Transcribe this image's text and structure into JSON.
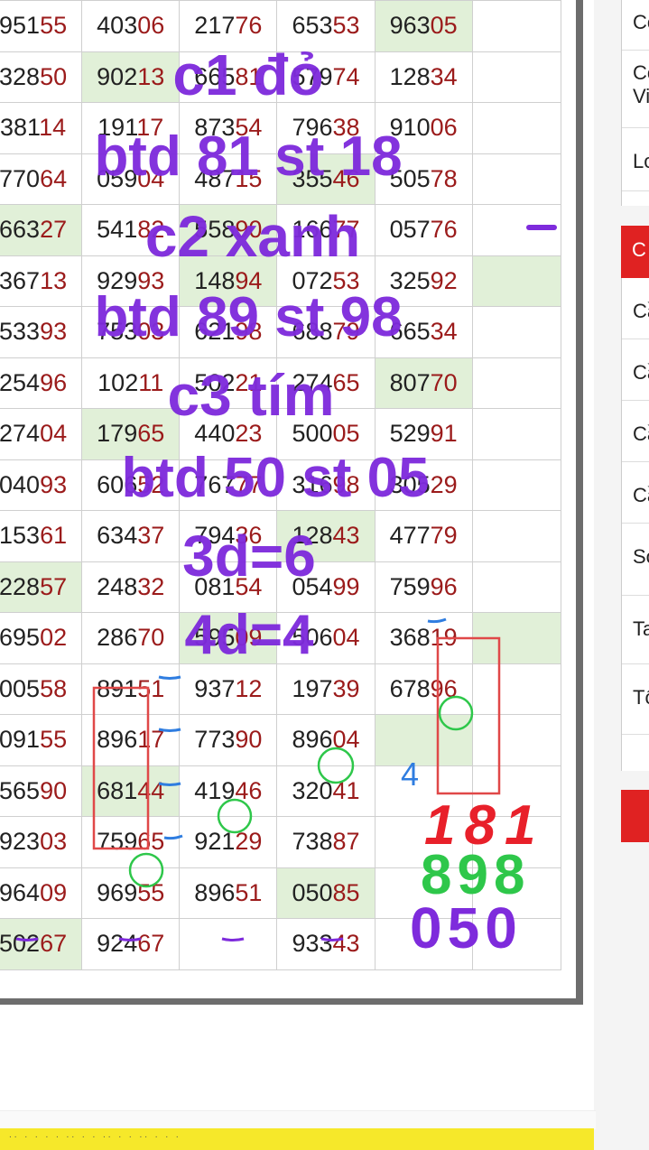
{
  "table": {
    "rows": [
      [
        {
          "v": "95155"
        },
        {
          "v": "40306"
        },
        {
          "v": "21776"
        },
        {
          "v": "65353"
        },
        {
          "v": "96305",
          "hl": true
        },
        {
          "v": ""
        }
      ],
      [
        {
          "v": "32850"
        },
        {
          "v": "90213",
          "hl": true
        },
        {
          "v": "66581"
        },
        {
          "v": "57974"
        },
        {
          "v": "12834"
        },
        {
          "v": ""
        }
      ],
      [
        {
          "v": "38114"
        },
        {
          "v": "19117"
        },
        {
          "v": "87354"
        },
        {
          "v": "79638"
        },
        {
          "v": "91006"
        },
        {
          "v": ""
        }
      ],
      [
        {
          "v": "77064"
        },
        {
          "v": "05904"
        },
        {
          "v": "48715"
        },
        {
          "v": "35546",
          "hl": true
        },
        {
          "v": "50578"
        },
        {
          "v": ""
        }
      ],
      [
        {
          "v": "66327",
          "hl": true
        },
        {
          "v": "54182"
        },
        {
          "v": "55890",
          "hl": true
        },
        {
          "v": "16677"
        },
        {
          "v": "05776"
        },
        {
          "v": ""
        }
      ],
      [
        {
          "v": "36713"
        },
        {
          "v": "92993"
        },
        {
          "v": "14894",
          "hl": true
        },
        {
          "v": "07253"
        },
        {
          "v": "32592"
        },
        {
          "v": "",
          "hl": true
        }
      ],
      [
        {
          "v": "53393"
        },
        {
          "v": "75303"
        },
        {
          "v": "62198"
        },
        {
          "v": "68879"
        },
        {
          "v": "66534"
        },
        {
          "v": ""
        }
      ],
      [
        {
          "v": "25496"
        },
        {
          "v": "10211"
        },
        {
          "v": "50221"
        },
        {
          "v": "27465"
        },
        {
          "v": "80770",
          "hl": true
        },
        {
          "v": ""
        }
      ],
      [
        {
          "v": "27404"
        },
        {
          "v": "17965",
          "hl": true
        },
        {
          "v": "44023"
        },
        {
          "v": "50005"
        },
        {
          "v": "52991"
        },
        {
          "v": ""
        }
      ],
      [
        {
          "v": "04093"
        },
        {
          "v": "60652"
        },
        {
          "v": "76777"
        },
        {
          "v": "31698"
        },
        {
          "v": "30529"
        },
        {
          "v": ""
        }
      ],
      [
        {
          "v": "15361"
        },
        {
          "v": "63437"
        },
        {
          "v": "79436"
        },
        {
          "v": "12843",
          "hl": true
        },
        {
          "v": "47779"
        },
        {
          "v": ""
        }
      ],
      [
        {
          "v": "22857",
          "hl": true
        },
        {
          "v": "24832"
        },
        {
          "v": "08154"
        },
        {
          "v": "05499"
        },
        {
          "v": "75996"
        },
        {
          "v": ""
        }
      ],
      [
        {
          "v": "69502"
        },
        {
          "v": "28670"
        },
        {
          "v": "59509",
          "hl": true
        },
        {
          "v": "50604"
        },
        {
          "v": "36819"
        },
        {
          "v": "",
          "hl": true
        }
      ],
      [
        {
          "v": "00558"
        },
        {
          "v": "89151"
        },
        {
          "v": "93712"
        },
        {
          "v": "19739"
        },
        {
          "v": "67896"
        },
        {
          "v": ""
        }
      ],
      [
        {
          "v": "09155"
        },
        {
          "v": "89617"
        },
        {
          "v": "77390"
        },
        {
          "v": "89604"
        },
        {
          "v": "",
          "hl": true
        },
        {
          "v": ""
        }
      ],
      [
        {
          "v": "56590"
        },
        {
          "v": "68144",
          "hl": true
        },
        {
          "v": "41946"
        },
        {
          "v": "32041"
        },
        {
          "v": ""
        },
        {
          "v": ""
        }
      ],
      [
        {
          "v": "92303"
        },
        {
          "v": "75965"
        },
        {
          "v": "92129"
        },
        {
          "v": "73887"
        },
        {
          "v": ""
        },
        {
          "v": ""
        }
      ],
      [
        {
          "v": "96409"
        },
        {
          "v": "96955"
        },
        {
          "v": "89651"
        },
        {
          "v": "05085",
          "hl": true
        },
        {
          "v": ""
        },
        {
          "v": ""
        }
      ],
      [
        {
          "v": "50267",
          "hl": true
        },
        {
          "v": "92467"
        },
        {
          "v": ""
        },
        {
          "v": "93343"
        },
        {
          "v": ""
        },
        {
          "v": ""
        }
      ]
    ]
  },
  "side_panel": {
    "card1": [
      "Cơ",
      "Cơ Vi",
      "Lo"
    ],
    "red1": "C",
    "card2": [
      "Cầ",
      "Cầ",
      "Cầ",
      "Cầ",
      "Sơ",
      "Ta",
      "Tô"
    ]
  },
  "annotations": {
    "line1": "c1 đỏ",
    "line2": "btd 81 st 18",
    "line3": "c2 xanh",
    "line4": "btd 89 st 98",
    "line5": "c3 tím",
    "line6": "btd 50 st 05",
    "line7": "3d=6",
    "line8": "4d=4",
    "digit_4": "4",
    "red_digits": "181",
    "green_digits": "898",
    "purple_digits": "050",
    "dash": "-",
    "colors": {
      "purple": "#7e2bdc",
      "red": "#e8202a",
      "green": "#2ec74a",
      "blue": "#2f7de0"
    }
  },
  "footer": {
    "yellow_text": "..  .  .  .  .  ..  .  .  ..  .  .  ..  .  .  ."
  }
}
